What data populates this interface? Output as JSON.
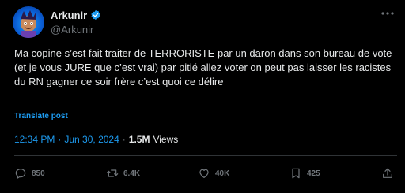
{
  "author": {
    "display_name": "Arkunir",
    "handle": "@Arkunir",
    "verified_color": "#1d9bf0",
    "avatar_icon": "character-avatar"
  },
  "tweet": {
    "text": "Ma copine s’est fait traiter de TERRORISTE par un daron dans son bureau de vote (et je vous JURE que c’est vrai) par pitié allez voter on peut pas laisser les racistes du RN gagner ce soir frère c’est quoi ce délire",
    "translate_label": "Translate post"
  },
  "meta": {
    "time": "12:34 PM",
    "separator": "·",
    "date": "Jun 30, 2024",
    "views_count": "1.5M",
    "views_label": "Views"
  },
  "actions": {
    "reply_count": "850",
    "repost_count": "6.4K",
    "like_count": "40K",
    "bookmark_count": "425"
  },
  "colors": {
    "background": "#000000",
    "text": "#e7e9ea",
    "muted": "#71767b",
    "accent": "#1d9bf0",
    "divider": "#2f3336"
  }
}
